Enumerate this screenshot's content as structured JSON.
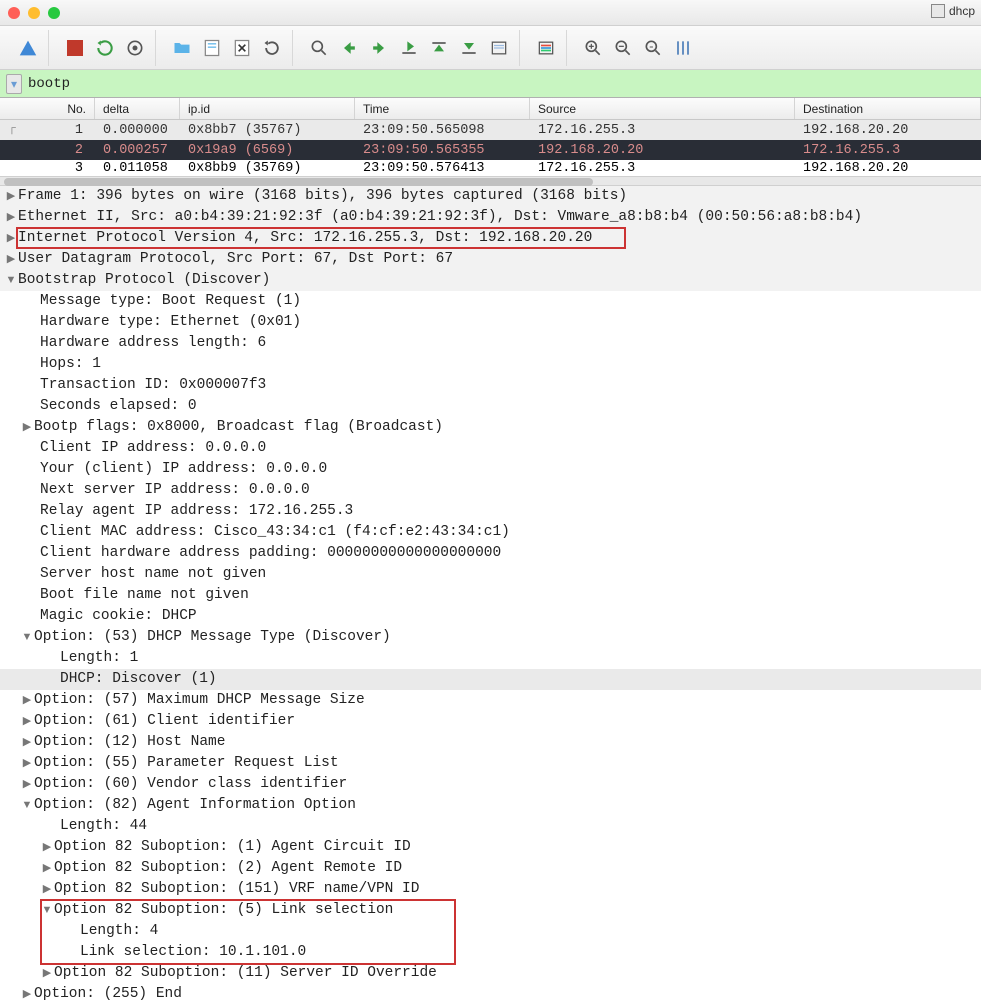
{
  "window": {
    "title_right": "dhcp"
  },
  "filter": {
    "value": "bootp"
  },
  "columns": {
    "no": "No.",
    "delta": "delta",
    "ipid": "ip.id",
    "time": "Time",
    "src": "Source",
    "dst": "Destination"
  },
  "packets": [
    {
      "no": "1",
      "delta": "0.000000",
      "ipid": "0x8bb7 (35767)",
      "time": "23:09:50.565098",
      "src": "172.16.255.3",
      "dst": "192.168.20.20",
      "sel": "top"
    },
    {
      "no": "2",
      "delta": "0.000257",
      "ipid": "0x19a9 (6569)",
      "time": "23:09:50.565355",
      "src": "192.168.20.20",
      "dst": "172.16.255.3",
      "sel": "main"
    },
    {
      "no": "3",
      "delta": "0.011058",
      "ipid": "0x8bb9 (35769)",
      "time": "23:09:50.576413",
      "src": "172.16.255.3",
      "dst": "192.168.20.20",
      "sel": "none"
    }
  ],
  "details": {
    "frame": "Frame 1: 396 bytes on wire (3168 bits), 396 bytes captured (3168 bits)",
    "eth": "Ethernet II, Src: a0:b4:39:21:92:3f (a0:b4:39:21:92:3f), Dst: Vmware_a8:b8:b4 (00:50:56:a8:b8:b4)",
    "ip": "Internet Protocol Version 4, Src: 172.16.255.3, Dst: 192.168.20.20",
    "udp": "User Datagram Protocol, Src Port: 67, Dst Port: 67",
    "bootp_hdr": "Bootstrap Protocol (Discover)",
    "bootp": {
      "msgtype": "Message type: Boot Request (1)",
      "hwtype": "Hardware type: Ethernet (0x01)",
      "hwaddrlen": "Hardware address length: 6",
      "hops": "Hops: 1",
      "txid": "Transaction ID: 0x000007f3",
      "secs": "Seconds elapsed: 0",
      "flags": "Bootp flags: 0x8000, Broadcast flag (Broadcast)",
      "ciaddr": "Client IP address: 0.0.0.0",
      "yiaddr": "Your (client) IP address: 0.0.0.0",
      "niaddr": "Next server IP address: 0.0.0.0",
      "riaddr": "Relay agent IP address: 172.16.255.3",
      "chaddr": "Client MAC address: Cisco_43:34:c1 (f4:cf:e2:43:34:c1)",
      "pad": "Client hardware address padding: 00000000000000000000",
      "sname": "Server host name not given",
      "bfile": "Boot file name not given",
      "cookie": "Magic cookie: DHCP",
      "opt53": "Option: (53) DHCP Message Type (Discover)",
      "opt53_len": "Length: 1",
      "opt53_val": "DHCP: Discover (1)",
      "opt57": "Option: (57) Maximum DHCP Message Size",
      "opt61": "Option: (61) Client identifier",
      "opt12": "Option: (12) Host Name",
      "opt55": "Option: (55) Parameter Request List",
      "opt60": "Option: (60) Vendor class identifier",
      "opt82": "Option: (82) Agent Information Option",
      "opt82_len": "Length: 44",
      "opt82_s1": "Option 82 Suboption: (1) Agent Circuit ID",
      "opt82_s2": "Option 82 Suboption: (2) Agent Remote ID",
      "opt82_s151": "Option 82 Suboption: (151) VRF name/VPN ID",
      "opt82_s5": "Option 82 Suboption: (5) Link selection",
      "opt82_s5_len": "Length: 4",
      "opt82_s5_val": "Link selection: 10.1.101.0",
      "opt82_s11": "Option 82 Suboption: (11) Server ID Override",
      "opt255": "Option: (255) End"
    }
  }
}
